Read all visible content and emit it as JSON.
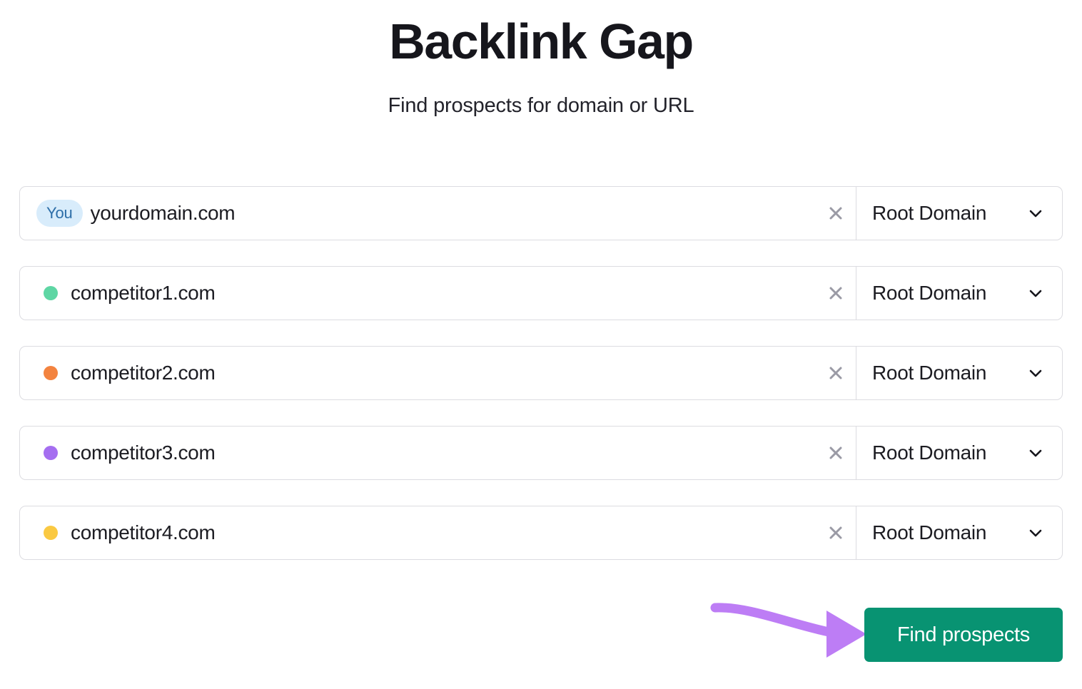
{
  "header": {
    "title": "Backlink Gap",
    "subtitle": "Find prospects for domain or URL"
  },
  "colors": {
    "accent_button": "#089372",
    "annotation_arrow": "#bd7df5",
    "badge_bg": "#d8ecfb",
    "badge_text": "#2d6ea8",
    "row_border": "#dcdce1",
    "clear_icon": "#9a9aa5"
  },
  "rows": [
    {
      "badge": "You",
      "marker_type": "badge",
      "marker_color": "#d8ecfb",
      "domain": "yourdomain.com",
      "clear_icon": "close-icon",
      "scope": "Root Domain",
      "scope_icon": "chevron-down-icon"
    },
    {
      "badge": "",
      "marker_type": "dot",
      "marker_color": "#5ed6a4",
      "domain": "competitor1.com",
      "clear_icon": "close-icon",
      "scope": "Root Domain",
      "scope_icon": "chevron-down-icon"
    },
    {
      "badge": "",
      "marker_type": "dot",
      "marker_color": "#f3833f",
      "domain": "competitor2.com",
      "clear_icon": "close-icon",
      "scope": "Root Domain",
      "scope_icon": "chevron-down-icon"
    },
    {
      "badge": "",
      "marker_type": "dot",
      "marker_color": "#a56ef0",
      "domain": "competitor3.com",
      "clear_icon": "close-icon",
      "scope": "Root Domain",
      "scope_icon": "chevron-down-icon"
    },
    {
      "badge": "",
      "marker_type": "dot",
      "marker_color": "#fac942",
      "domain": "competitor4.com",
      "clear_icon": "close-icon",
      "scope": "Root Domain",
      "scope_icon": "chevron-down-icon"
    }
  ],
  "action": {
    "find_label": "Find prospects",
    "annotation": "curved-arrow-pointing-right"
  }
}
